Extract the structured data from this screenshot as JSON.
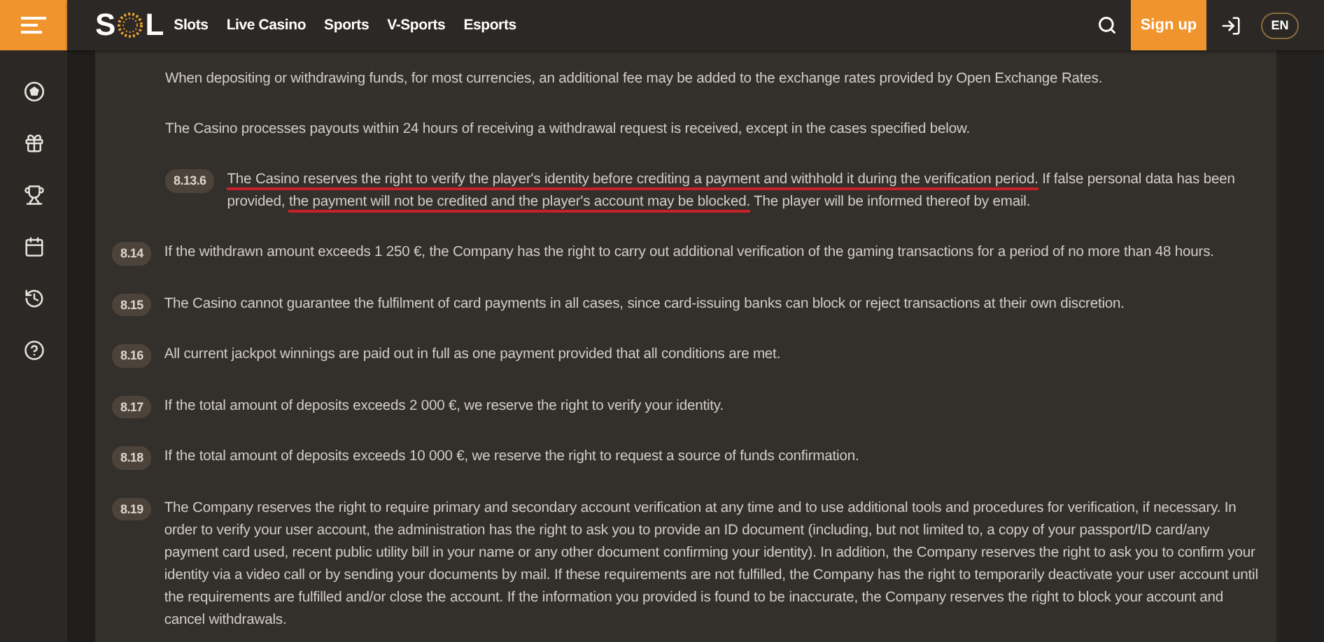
{
  "header": {
    "logo": {
      "before": "S",
      "after": "L"
    },
    "nav": [
      {
        "label": "Slots"
      },
      {
        "label": "Live Casino"
      },
      {
        "label": "Sports"
      },
      {
        "label": "V-Sports"
      },
      {
        "label": "Esports"
      }
    ],
    "signup": "Sign up",
    "language": "EN"
  },
  "clauses": [
    {
      "kind": "note",
      "text": "When depositing or withdrawing funds, for most currencies, an additional fee may be added to the exchange rates provided by Open Exchange Rates."
    },
    {
      "kind": "note",
      "text": "The Casino processes payouts within 24 hours of receiving a withdrawal request is received, except in the cases specified below."
    },
    {
      "kind": "subclause",
      "number": "8.13.6",
      "segments": [
        {
          "text": "The Casino reserves the right to verify the player's identity before crediting a payment and withhold it during the verification period.",
          "underlined": true
        },
        {
          "text": " If false personal data has been provided, ",
          "underlined": false
        },
        {
          "text": "the payment will not be credited and the player's account may be blocked.",
          "underlined": true
        },
        {
          "text": " The player will be informed thereof by email.",
          "underlined": false
        }
      ]
    },
    {
      "kind": "clause",
      "number": "8.14",
      "text": "If the withdrawn amount exceeds 1 250 €, the Company has the right to carry out additional verification of the gaming transactions for a period of no more than 48 hours."
    },
    {
      "kind": "clause",
      "number": "8.15",
      "text": "The Casino cannot guarantee the fulfilment of card payments in all cases, since card-issuing banks can block or reject transactions at their own discretion."
    },
    {
      "kind": "clause",
      "number": "8.16",
      "text": "All current jackpot winnings are paid out in full as one payment provided that all conditions are met."
    },
    {
      "kind": "clause",
      "number": "8.17",
      "text": "If the total amount of deposits exceeds 2 000 €, we reserve the right to verify your identity."
    },
    {
      "kind": "clause",
      "number": "8.18",
      "text": "If the total amount of deposits exceeds 10 000 €, we reserve the right to request a source of funds confirmation."
    },
    {
      "kind": "clause",
      "number": "8.19",
      "text": "The Company reserves the right to require primary and secondary account verification at any time and to use additional tools and procedures for verification, if necessary. In order to verify your user account, the administration has the right to ask you to provide an ID document (including, but not limited to, a copy of your passport/ID card/any payment card used, recent public utility bill in your name or any other document confirming your identity). In addition, the Company reserves the right to ask you to confirm your identity via a video call or by sending your documents by mail. If these requirements are not fulfilled, the Company has the right to temporarily deactivate your user account until the requirements are fulfilled and/or close the account. If the information you provided is found to be inaccurate, the Company reserves the right to block your account and cancel withdrawals."
    }
  ]
}
